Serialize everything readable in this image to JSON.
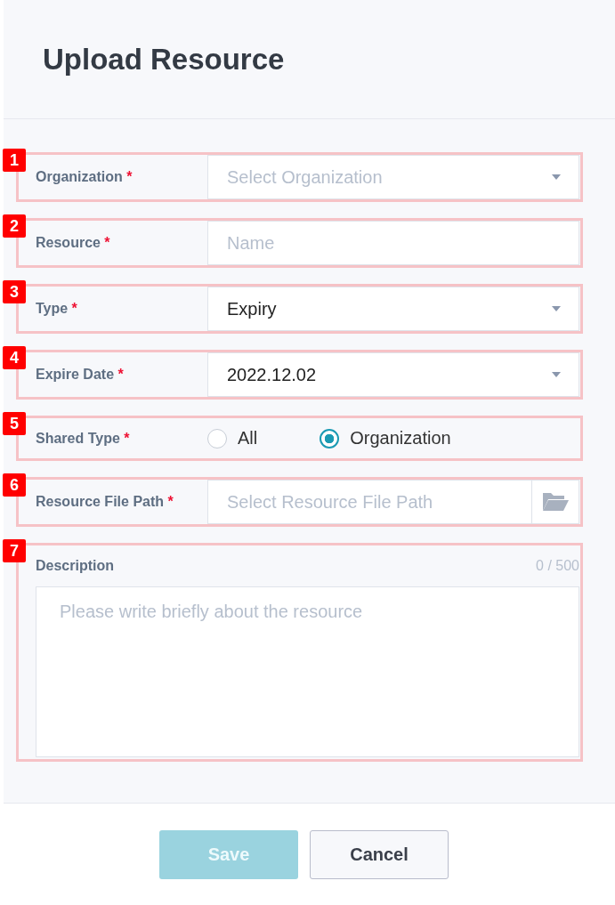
{
  "title": "Upload Resource",
  "fields": [
    {
      "callout": "1",
      "kind": "select",
      "label": "Organization",
      "required_mark": "*",
      "placeholder": "Select Organization"
    },
    {
      "callout": "2",
      "kind": "input",
      "label": "Resource",
      "required_mark": "*",
      "placeholder": "Name"
    },
    {
      "callout": "3",
      "kind": "select",
      "label": "Type",
      "required_mark": "*",
      "value": "Expiry"
    },
    {
      "callout": "4",
      "kind": "select",
      "label": "Expire Date",
      "required_mark": "*",
      "value": "2022.12.02"
    },
    {
      "callout": "5",
      "kind": "radio",
      "label": "Shared Type",
      "required_mark": "*",
      "options": [
        {
          "label": "All",
          "selected": false
        },
        {
          "label": "Organization",
          "selected": true
        }
      ]
    },
    {
      "callout": "6",
      "kind": "file",
      "label": "Resource File Path",
      "required_mark": "*",
      "placeholder": "Select Resource File Path"
    },
    {
      "callout": "7",
      "kind": "textarea",
      "label": "Description",
      "counter": "0 / 500",
      "placeholder": "Please write briefly about the resource"
    }
  ],
  "buttons": [
    {
      "label": "Save",
      "kind": "primary",
      "disabled": true
    },
    {
      "label": "Cancel",
      "kind": "secondary",
      "disabled": false
    }
  ]
}
